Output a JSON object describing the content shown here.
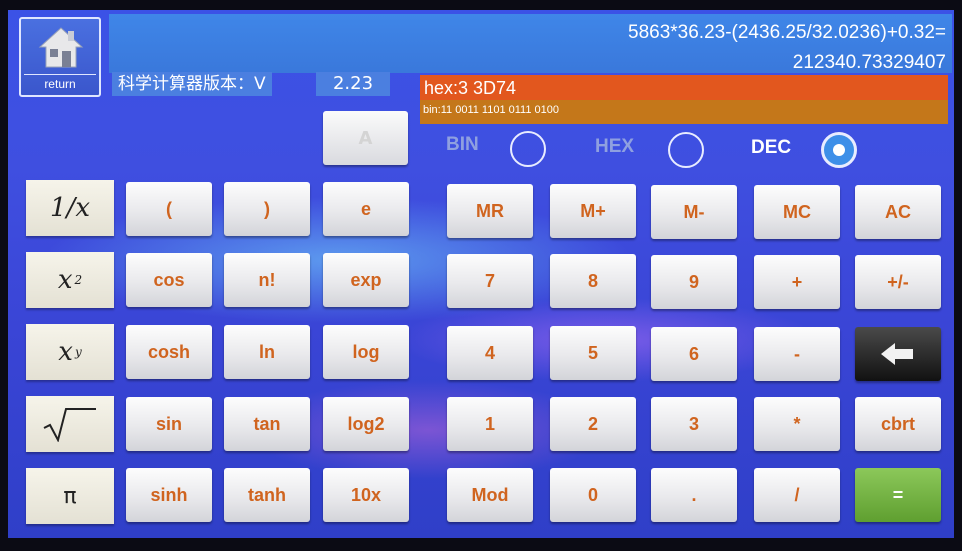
{
  "display": {
    "expression": "5863*36.23-(2436.25/32.0236)+0.32=",
    "result": "212340.73329407"
  },
  "return_label": "return",
  "version": {
    "label": "科学计算器版本：V",
    "value": "2.23"
  },
  "hex_readout": "hex:3 3D74",
  "bin_readout": "bin:11 0011 1101 0111 0100",
  "a_key": "A",
  "modes": {
    "bin": "BIN",
    "hex": "HEX",
    "dec": "DEC",
    "selected": "DEC"
  },
  "function_keys": {
    "reciprocal": "1/x",
    "pi": "π"
  },
  "keys": {
    "r1": [
      "(",
      ")",
      "e",
      "MR",
      "M+",
      "M-",
      "MC",
      "AC"
    ],
    "r2": [
      "cos",
      "n!",
      "exp",
      "7",
      "8",
      "9",
      "+",
      "+/-"
    ],
    "r3": [
      "cosh",
      "ln",
      "log",
      "4",
      "5",
      "6",
      "-"
    ],
    "r4": [
      "sin",
      "tan",
      "log2",
      "1",
      "2",
      "3",
      "*",
      "cbrt"
    ],
    "r5": [
      "sinh",
      "tanh",
      "10x",
      "Mod",
      "0",
      ".",
      "/",
      "="
    ]
  },
  "colors": {
    "key_text": "#d0641f",
    "hex_bar": "#e2571e",
    "bin_bar": "#c4771a",
    "equals_key": "#6aa83a"
  },
  "icons": {
    "return": "house-icon",
    "backspace": "arrow-left-icon"
  }
}
